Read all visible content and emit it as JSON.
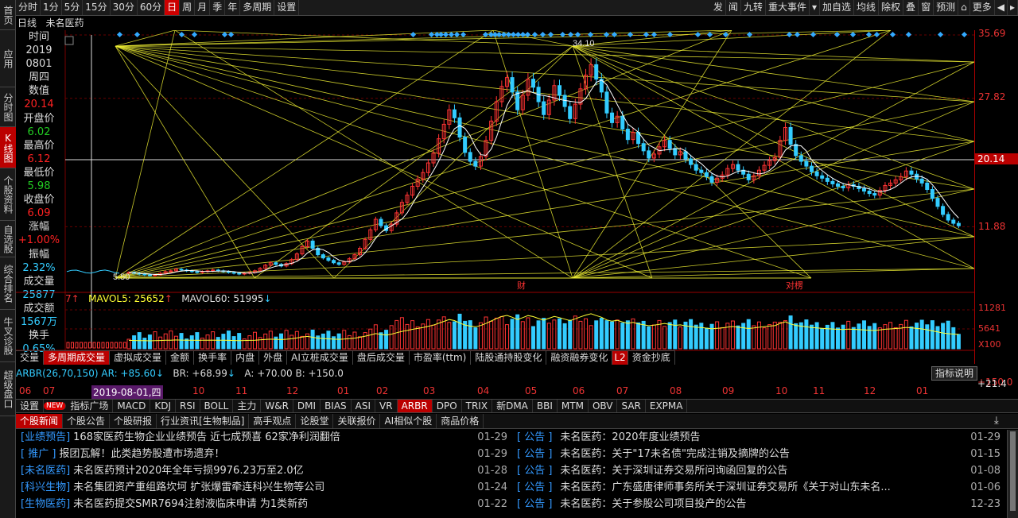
{
  "left_nav": [
    "首页",
    "应用",
    "分时图",
    "K线图",
    "个股资料",
    "自选股",
    "综合排名",
    "牛叉诊股",
    "超级盘口"
  ],
  "periods": [
    "分时",
    "1分",
    "5分",
    "15分",
    "30分",
    "60分",
    "日",
    "周",
    "月",
    "季",
    "年",
    "多周期",
    "设置"
  ],
  "top_right": [
    "发",
    "闻",
    "九转",
    "重大事件",
    "▾",
    "加自选",
    "均线",
    "除权",
    "叠",
    "窗",
    "预测",
    "⌂",
    "更多",
    "◀",
    "▸"
  ],
  "title": {
    "period": "日线",
    "name": "未名医药"
  },
  "info": {
    "time_label": "时间",
    "year": "2019",
    "date": "0801",
    "weekday": "周四",
    "value_label": "数值",
    "value": "20.14",
    "open_label": "开盘价",
    "open": "6.02",
    "high_label": "最高价",
    "high": "6.12",
    "low_label": "最低价",
    "low": "5.98",
    "close_label": "收盘价",
    "close": "6.09",
    "change_label": "涨幅",
    "change": "+1.00%",
    "amp_label": "振幅",
    "amp": "2.32%",
    "vol_label": "成交量",
    "vol": "25877",
    "amt_label": "成交额",
    "amt": "1567万",
    "turnover_label": "换手",
    "turnover": "0.65%"
  },
  "price_axis": [
    "35.69",
    "27.82",
    "20.14",
    "11.88"
  ],
  "peak_label": "34.10",
  "low_label": "5.50",
  "event_marks": [
    "财",
    "对楞"
  ],
  "volume": {
    "prefix": "7",
    "mavol5": "MAVOL5: 25652",
    "mavol60": "MAVOL60: 51995"
  },
  "vol_axis": [
    "11281",
    "5641",
    "X100"
  ],
  "sub_tabs": [
    "交量",
    "多周期成交量",
    "虚拟成交量",
    "金额",
    "换手率",
    "内盘",
    "外盘",
    "AI立桩成交量",
    "盘后成交量",
    "市盈率(ttm)",
    "陆股通持股变化",
    "融资融券变化",
    "L2",
    "资金抄底"
  ],
  "arbr": {
    "title": "ARBR(26,70,150)",
    "ar": "AR: +85.60",
    "br": "BR: +68.99",
    "a": "A: +70.00",
    "b": "B: +150.0",
    "btn": "指标说明",
    "right": "+150.0",
    "right2": "+21.4"
  },
  "dates": [
    "06",
    "07",
    "2019-08-01,四",
    "10",
    "11",
    "12",
    "01",
    "02",
    "03",
    "04",
    "05",
    "06",
    "07",
    "08",
    "09",
    "10",
    "11",
    "12",
    "01"
  ],
  "indicators": [
    "设置",
    "NEW",
    "指标广场",
    "MACD",
    "KDJ",
    "RSI",
    "BOLL",
    "主力",
    "W&R",
    "DMI",
    "BIAS",
    "ASI",
    "VR",
    "ARBR",
    "DPO",
    "TRIX",
    "新DMA",
    "BBI",
    "MTM",
    "OBV",
    "SAR",
    "EXPMA"
  ],
  "news_tabs": [
    "个股新闻",
    "个股公告",
    "个股研报",
    "行业资讯[生物制品]",
    "高手观点",
    "论股堂",
    "关联报价",
    "AI相似个股",
    "商品价格"
  ],
  "news_left": [
    {
      "cat": "[业绩预告]",
      "title": "168家医药生物企业业绩预告 近七成预喜 62家净利润翻倍",
      "date": "01-29"
    },
    {
      "cat": "[  推广  ]",
      "title": "报团瓦解！此类趋势股遭市场遗弃！",
      "date": "01-29"
    },
    {
      "cat": "[未名医药]",
      "title": "未名医药预计2020年全年亏损9976.23万至2.0亿",
      "date": "01-28"
    },
    {
      "cat": "[科兴生物]",
      "title": "未名集团资产重组路坎坷 扩张爆雷牵连科兴生物等公司",
      "date": "01-24"
    },
    {
      "cat": "[生物医药]",
      "title": "未名医药提交SMR7694注射液临床申请 为1类新药",
      "date": "01-22"
    }
  ],
  "news_right": [
    {
      "cat": "[  公告  ]",
      "title": "未名医药：2020年度业绩预告",
      "date": "01-29"
    },
    {
      "cat": "[  公告  ]",
      "title": "未名医药：关于\"17未名债\"完成注销及摘牌的公告",
      "date": "01-15"
    },
    {
      "cat": "[  公告  ]",
      "title": "未名医药：关于深圳证券交易所问询函回复的公告",
      "date": "01-08"
    },
    {
      "cat": "[  公告  ]",
      "title": "未名医药：广东盛唐律师事务所关于深圳证券交易所《关于对山东未名...",
      "date": "01-06"
    },
    {
      "cat": "[  公告  ]",
      "title": "未名医药：关于参股公司项目投产的公告",
      "date": "12-23"
    }
  ],
  "colors": {
    "up": "#ff3333",
    "down": "#33ccff",
    "gann": "#ffff33",
    "accent": "#cc0000"
  },
  "chart_data": {
    "type": "candlestick",
    "closes": [
      6.2,
      6.1,
      6.0,
      5.9,
      5.8,
      5.9,
      6.1,
      6.3,
      6.4,
      6.6,
      6.5,
      6.4,
      6.3,
      6.2,
      6.3,
      6.4,
      6.5,
      6.4,
      6.3,
      6.2,
      6.1,
      6.0,
      6.1,
      6.2,
      6.4,
      6.7,
      7.1,
      7.4,
      7.2,
      7.0,
      7.3,
      7.8,
      8.5,
      9.4,
      10.1,
      9.2,
      8.4,
      8.0,
      7.7,
      7.4,
      7.2,
      7.5,
      7.9,
      8.4,
      9.2,
      10.3,
      11.5,
      12.8,
      12.0,
      11.4,
      12.2,
      13.6,
      14.9,
      15.8,
      16.9,
      17.8,
      18.6,
      19.8,
      21.0,
      22.8,
      24.6,
      26.4,
      25.4,
      23.0,
      21.1,
      20.0,
      19.4,
      20.6,
      22.6,
      25.0,
      27.4,
      29.3,
      30.4,
      28.6,
      26.4,
      28.2,
      30.2,
      29.2,
      27.4,
      25.8,
      27.6,
      29.4,
      28.2,
      26.8,
      25.3,
      27.1,
      29.0,
      30.7,
      32.0,
      30.2,
      28.6,
      26.0,
      24.8,
      25.6,
      24.0,
      22.7,
      23.6,
      22.2,
      21.3,
      20.4,
      20.9,
      21.8,
      22.6,
      21.6,
      20.8,
      21.2,
      20.3,
      19.6,
      18.9,
      18.6,
      18.1,
      17.4,
      17.9,
      18.3,
      19.1,
      19.6,
      18.9,
      18.4,
      17.7,
      18.2,
      18.9,
      19.5,
      20.1,
      20.5,
      22.6,
      24.2,
      22.1,
      20.7,
      20.0,
      19.4,
      18.7,
      18.2,
      17.9,
      17.5,
      17.2,
      16.9,
      16.7,
      17.1,
      16.9,
      16.6,
      16.3,
      16.0,
      15.8,
      16.4,
      17.0,
      17.3,
      17.7,
      18.1,
      18.8,
      18.4,
      17.8,
      17.3,
      16.5,
      15.4,
      14.4,
      13.4,
      12.7,
      12.3,
      12.0
    ],
    "ylim": [
      5.5,
      35.69
    ]
  }
}
